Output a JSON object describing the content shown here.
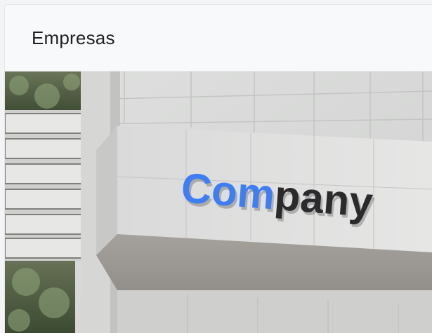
{
  "card": {
    "title": "Empresas",
    "image": {
      "logo_part_1": "Com",
      "logo_part_2": "pany",
      "logo_color_1": "#3f7ef2",
      "logo_color_2": "#2b2b2d"
    }
  }
}
